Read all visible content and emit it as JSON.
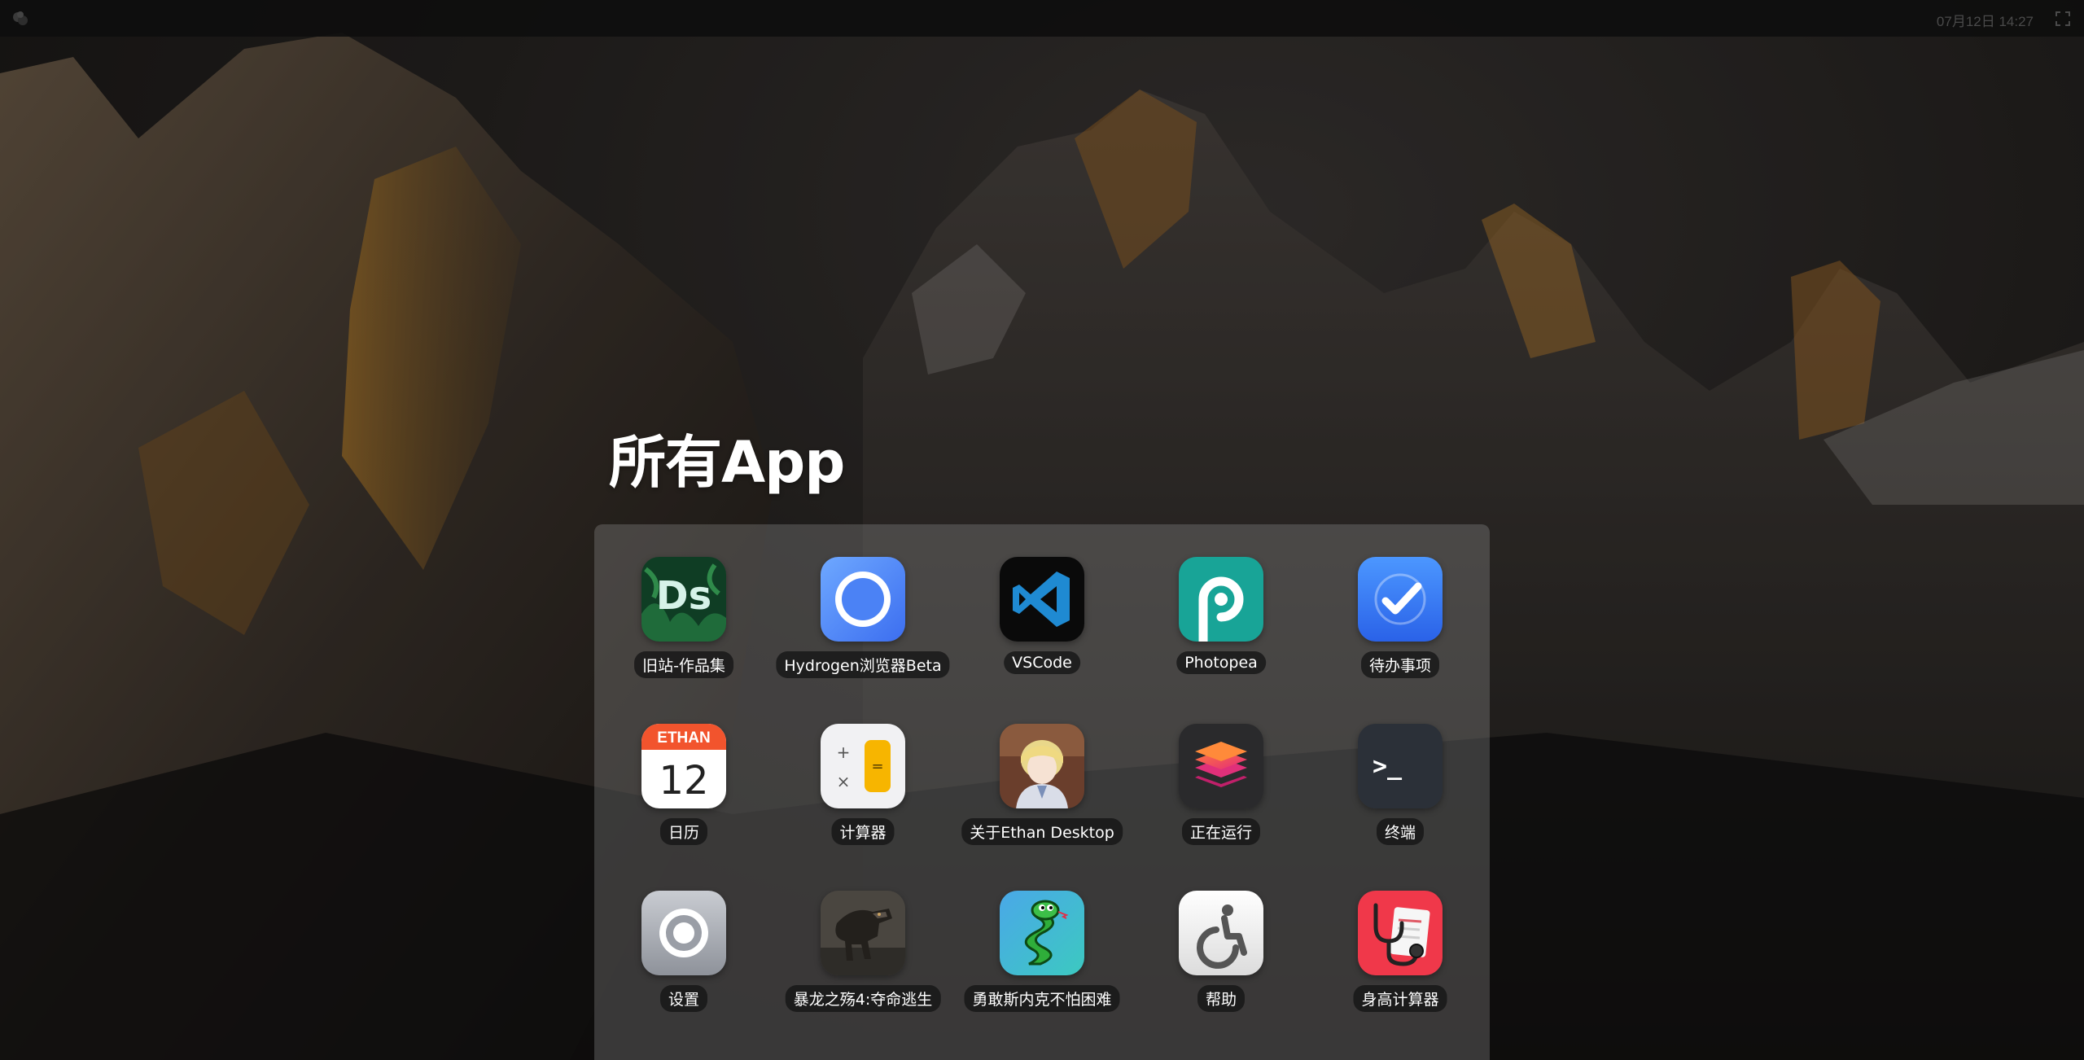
{
  "topbar": {
    "logo_icon": "ethan-desktop-logo-icon",
    "clock": "07月12日 14:27",
    "fullscreen_icon": "fullscreen-icon"
  },
  "launcher": {
    "title": "所有App",
    "apps": [
      {
        "label": "旧站-作品集",
        "icon": "ds-portfolio-icon"
      },
      {
        "label": "Hydrogen浏览器Beta",
        "icon": "browser-icon"
      },
      {
        "label": "VSCode",
        "icon": "vscode-icon"
      },
      {
        "label": "Photopea",
        "icon": "photopea-icon"
      },
      {
        "label": "待办事项",
        "icon": "todo-icon"
      },
      {
        "label": "日历",
        "icon": "calendar-icon",
        "header": "ETHAN",
        "day": "12"
      },
      {
        "label": "计算器",
        "icon": "calculator-icon"
      },
      {
        "label": "关于Ethan Desktop",
        "icon": "avatar-icon"
      },
      {
        "label": "正在运行",
        "icon": "layers-icon"
      },
      {
        "label": "终端",
        "icon": "terminal-icon",
        "prompt": ">_"
      },
      {
        "label": "设置",
        "icon": "settings-icon"
      },
      {
        "label": "暴龙之殇4:夺命逃生",
        "icon": "dinosaur-game-icon"
      },
      {
        "label": "勇敢斯内克不怕困难",
        "icon": "snake-game-icon"
      },
      {
        "label": "帮助",
        "icon": "accessibility-icon"
      },
      {
        "label": "身高计算器",
        "icon": "stethoscope-icon"
      }
    ]
  },
  "colors": {
    "wallpaper": "#1a1716",
    "panel": "#969696",
    "label_bg": "#141414",
    "accent_blue": "#2f7cf6"
  }
}
